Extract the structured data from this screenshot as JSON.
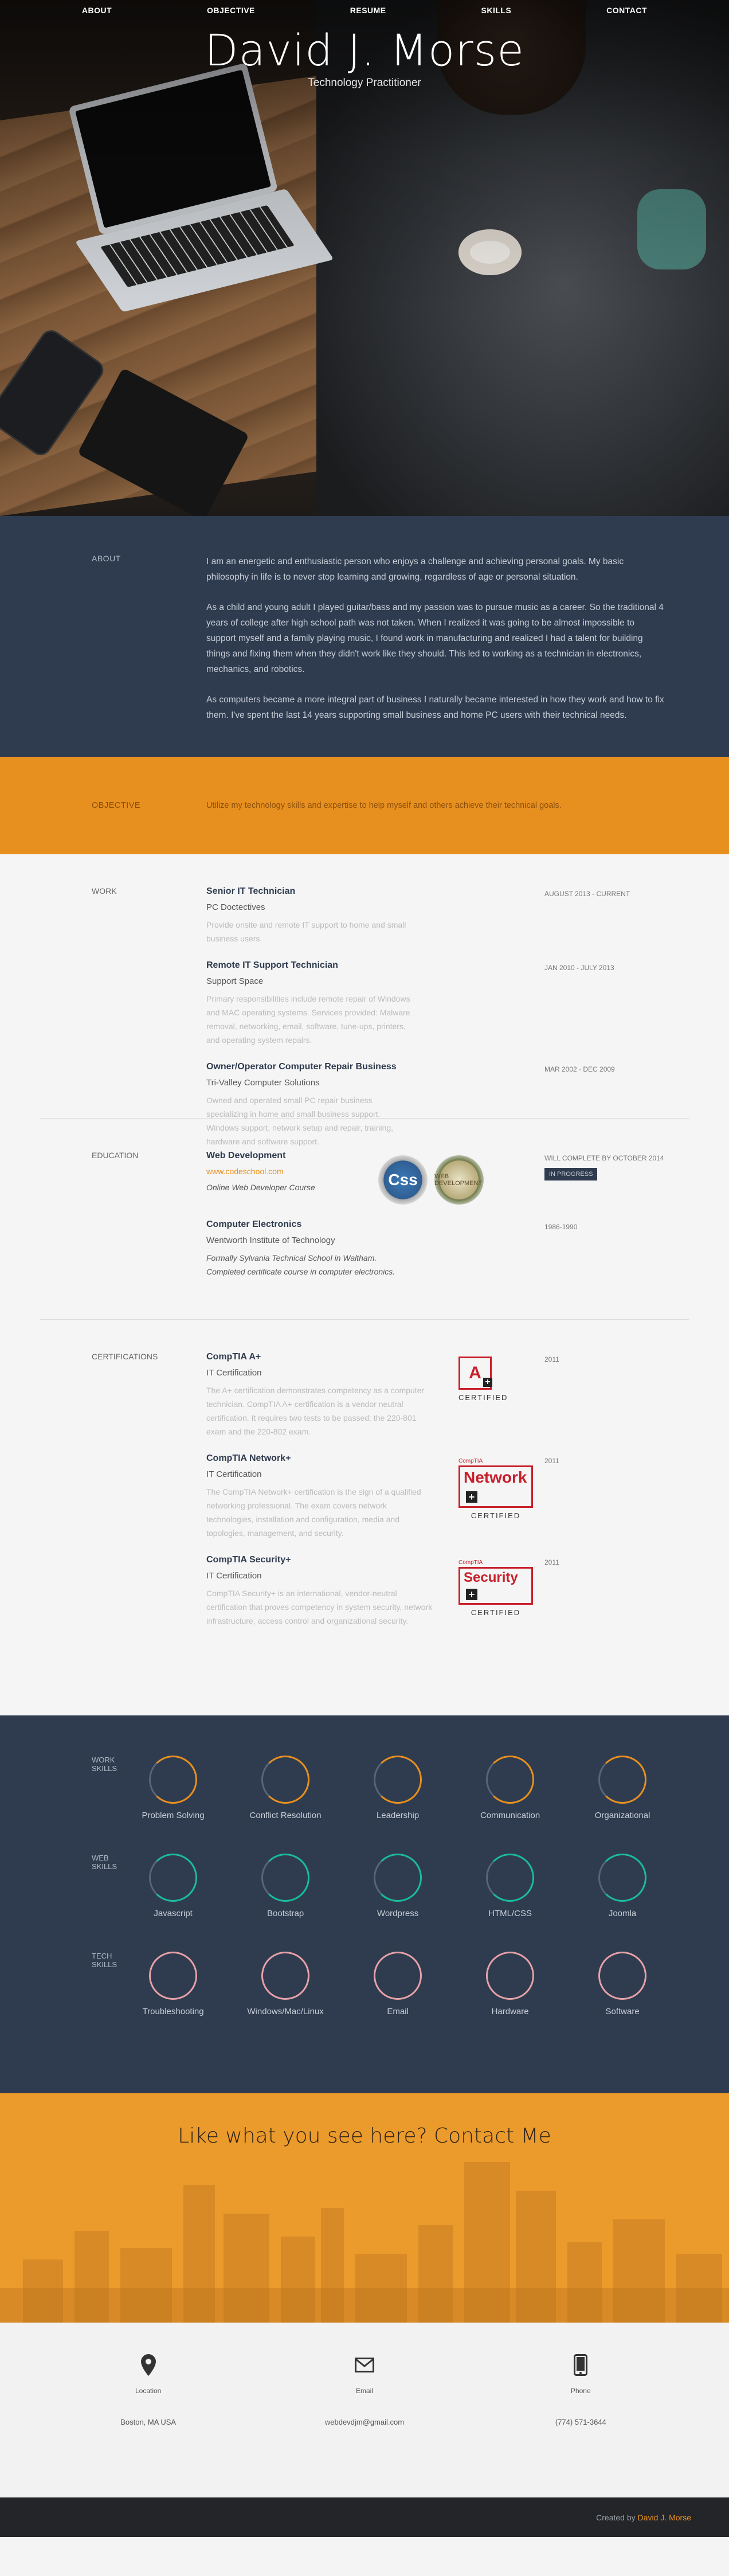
{
  "nav": {
    "items": [
      "ABOUT",
      "OBJECTIVE",
      "RESUME",
      "SKILLS",
      "CONTACT"
    ]
  },
  "hero": {
    "name": "David J. Morse",
    "tagline": "Technology Practitioner"
  },
  "about": {
    "label": "ABOUT",
    "paragraphs": [
      "I am an energetic and enthusiastic person who enjoys a challenge and achieving personal goals. My basic philosophy in life is to never stop learning and growing, regardless of age or personal situation.",
      "As a child and young adult I played guitar/bass and my passion was to pursue music as a career. So the traditional 4 years of college after high school path was not taken. When I realized it was going to be almost impossible to support myself and a family playing music, I found work in manufacturing and realized I had a talent for building things and fixing them when they didn't work like they should. This led to working as a technician in electronics, mechanics, and robotics.",
      "As computers became a more integral part of business I naturally became interested in how they work and how to fix them. I've spent the last 14 years supporting small business and home PC users with their technical needs."
    ]
  },
  "objective": {
    "label": "OBJECTIVE",
    "text": "Utilize my technology skills and expertise to help myself and others achieve their technical goals."
  },
  "work": {
    "label": "WORK",
    "jobs": [
      {
        "title": "Senior IT Technician",
        "org": "PC Doctectives",
        "desc": "Provide onsite and remote IT support to home and small business users.",
        "date": "AUGUST 2013 - CURRENT"
      },
      {
        "title": "Remote IT Support Technician",
        "org": "Support Space",
        "desc": "Primary responsibilities include remote repair of Windows and MAC operating systems. Services provided: Malware removal, networking, email, software, tune-ups, printers, and operating system repairs.",
        "date": "JAN 2010 - JULY 2013"
      },
      {
        "title": "Owner/Operator Computer Repair Business",
        "org": "Tri-Valley Computer Solutions",
        "desc": "Owned and operated small PC repair business specializing in home and small business support. Windows support, network setup and repair, training, hardware and software support.",
        "date": "MAR 2002 - DEC 2009"
      }
    ]
  },
  "education": {
    "label": "EDUCATION",
    "items": [
      {
        "title": "Web Development",
        "link": "www.codeschool.com",
        "note": "Online Web Developer Course",
        "date": "Will complete by OCTOBER 2014",
        "badge": "IN PROGRESS",
        "logos": [
          "Css",
          "WEB DEVELOPMENT"
        ]
      },
      {
        "title": "Computer Electronics",
        "org": "Wentworth Institute of Technology",
        "note": "Formally Sylvania Technical School in Waltham. Completed certificate course in computer electronics.",
        "date": "1986-1990"
      }
    ]
  },
  "certifications": {
    "label": "CERTIFICATIONS",
    "items": [
      {
        "title": "CompTIA A+",
        "org": "IT Certification",
        "desc": "The A+ certification demonstrates competency as a computer technician. CompTIA A+ certification is a vendor neutral certification. It requires two tests to be passed: the 220-801 exam and the 220-802 exam.",
        "date": "2011",
        "logo": {
          "mark": "A",
          "caption": "CERTIFIED"
        }
      },
      {
        "title": "CompTIA Network+",
        "org": "IT Certification",
        "desc": "The CompTIA Network+ certification is the sign of a qualified networking professional. The exam covers network technologies, installation and configuration, media and topologies, management, and security.",
        "date": "2011",
        "logo": {
          "small": "CompTIA",
          "mark": "Network",
          "caption": "CERTIFIED"
        }
      },
      {
        "title": "CompTIA Security+",
        "org": "IT Certification",
        "desc": "CompTIA Security+ is an international, vendor-neutral certification that proves competency in system security, network infrastructure, access control and organizational security.",
        "date": "2011",
        "logo": {
          "small": "CompTIA",
          "mark": "Security",
          "caption": "CERTIFIED"
        }
      }
    ]
  },
  "skills": {
    "groups": [
      {
        "label": "WORK SKILLS",
        "type": "work",
        "items": [
          "Problem Solving",
          "Conflict Resolution",
          "Leadership",
          "Communication",
          "Organizational"
        ]
      },
      {
        "label": "WEB SKILLS",
        "type": "web",
        "items": [
          "Javascript",
          "Bootstrap",
          "Wordpress",
          "HTML/CSS",
          "Joomla"
        ]
      },
      {
        "label": "TECH SKILLS",
        "type": "tech",
        "items": [
          "Troubleshooting",
          "Windows/Mac/Linux",
          "Email",
          "Hardware",
          "Software"
        ]
      }
    ]
  },
  "contact": {
    "heading": "Like what you see here? Contact Me",
    "items": [
      {
        "icon": "map-pin-icon",
        "label": "Location",
        "value": "Boston, MA USA"
      },
      {
        "icon": "envelope-icon",
        "label": "Email",
        "value": "webdevdjm@gmail.com"
      },
      {
        "icon": "phone-icon",
        "label": "Phone",
        "value": "(774) 571-3644"
      }
    ]
  },
  "footer": {
    "prefix": "Created by",
    "name": "David J. Morse"
  },
  "colors": {
    "navy": "#2f3c4f",
    "orange": "#e8901f",
    "teal": "#1abc9c",
    "pink": "#e7a1a8"
  }
}
